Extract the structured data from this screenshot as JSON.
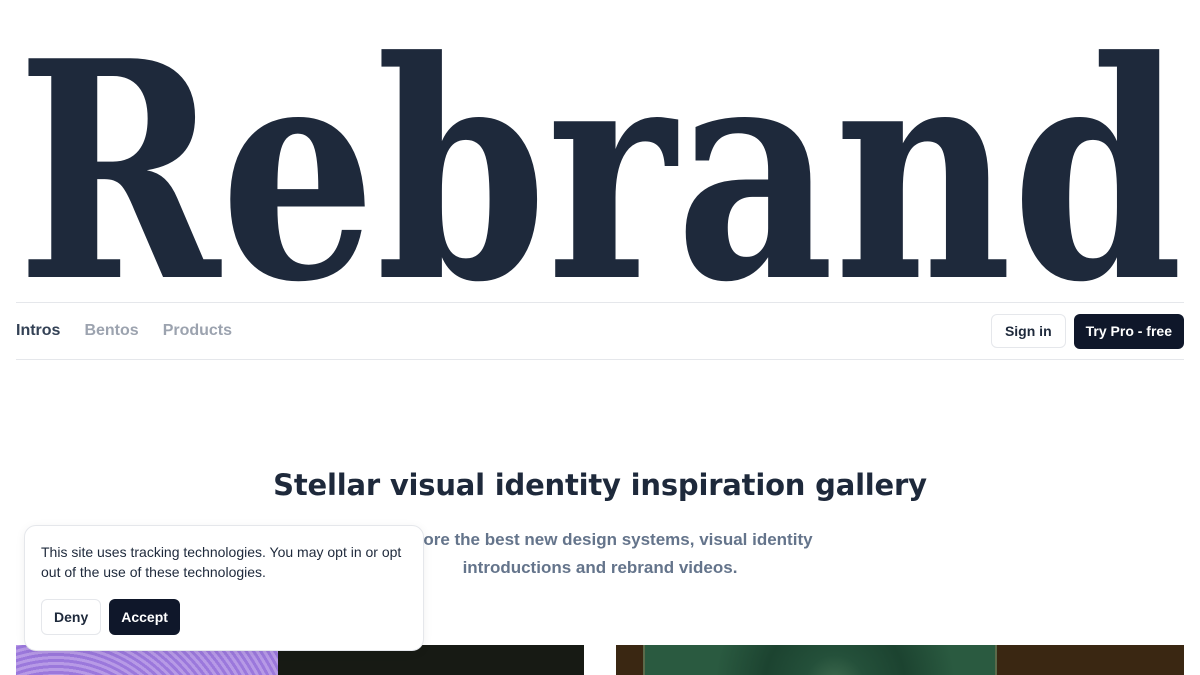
{
  "brand": {
    "logo_text": "Rebrand",
    "color": "#1e293b"
  },
  "nav": {
    "tabs": [
      {
        "label": "Intros",
        "active": true
      },
      {
        "label": "Bentos",
        "active": false
      },
      {
        "label": "Products",
        "active": false
      }
    ],
    "sign_in_label": "Sign in",
    "try_pro_label": "Try Pro - free"
  },
  "hero": {
    "title": "Stellar visual identity inspiration gallery",
    "subtitle": "Explore the best new design systems, visual identity introductions and rebrand videos."
  },
  "cookie_banner": {
    "text": "This site uses tracking technologies. You may opt in or opt out of the use of these technologies.",
    "deny_label": "Deny",
    "accept_label": "Accept"
  },
  "colors": {
    "accent": "#0f172a",
    "text": "#1e293b",
    "muted": "#9ca3af",
    "subtitle": "#64748b"
  }
}
